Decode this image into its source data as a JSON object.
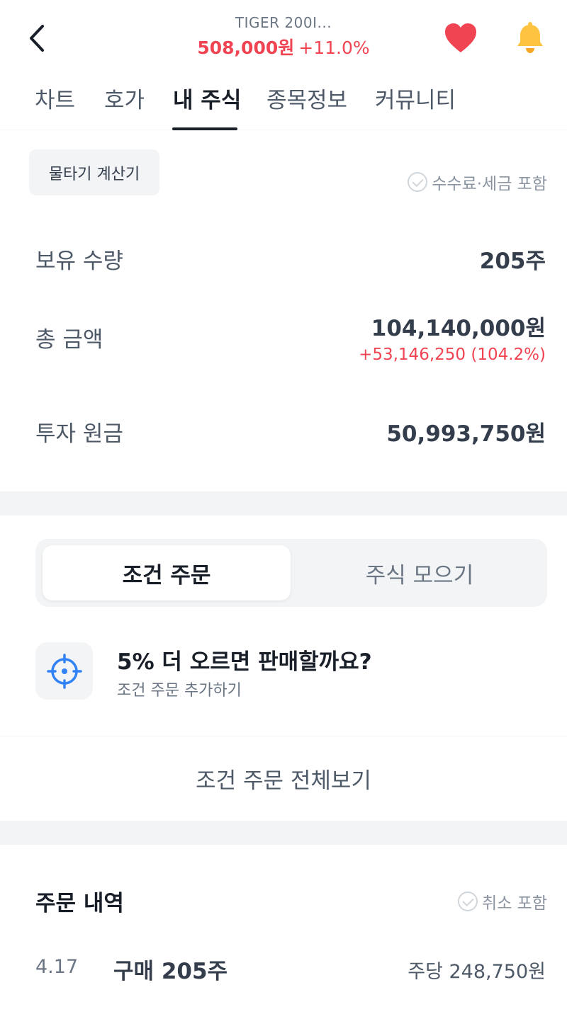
{
  "header": {
    "stock_name": "TIGER 200I...",
    "price": "508,000원",
    "change": "+11.0%",
    "price_color": "#f04452",
    "icons": {
      "back": "chevron-left-icon",
      "favorite": "heart-icon",
      "notification": "bell-icon"
    }
  },
  "tabs": [
    {
      "label": "차트",
      "active": false
    },
    {
      "label": "호가",
      "active": false
    },
    {
      "label": "내 주식",
      "active": true
    },
    {
      "label": "종목정보",
      "active": false
    },
    {
      "label": "커뮤니티",
      "active": false
    }
  ],
  "holdings": {
    "calc_button": "물타기 계산기",
    "fee_note": "수수료·세금 포함",
    "quantity_label": "보유 수량",
    "quantity_value": "205주",
    "total_label": "총 금액",
    "total_value": "104,140,000원",
    "total_profit": "+53,146,250 (104.2%)",
    "principal_label": "투자 원금",
    "principal_value": "50,993,750원"
  },
  "orders_segment": {
    "active_label": "조건 주문",
    "inactive_label": "주식 모으기"
  },
  "condition": {
    "title": "5% 더 오르면 판매할까요?",
    "subtitle": "조건 주문 추가하기",
    "icon": "target-icon",
    "view_all": "조건 주문 전체보기"
  },
  "order_history": {
    "title": "주문 내역",
    "note": "취소 포함",
    "rows": [
      {
        "date": "4.17",
        "desc": "구매 205주",
        "price": "주당 248,750원"
      }
    ]
  }
}
